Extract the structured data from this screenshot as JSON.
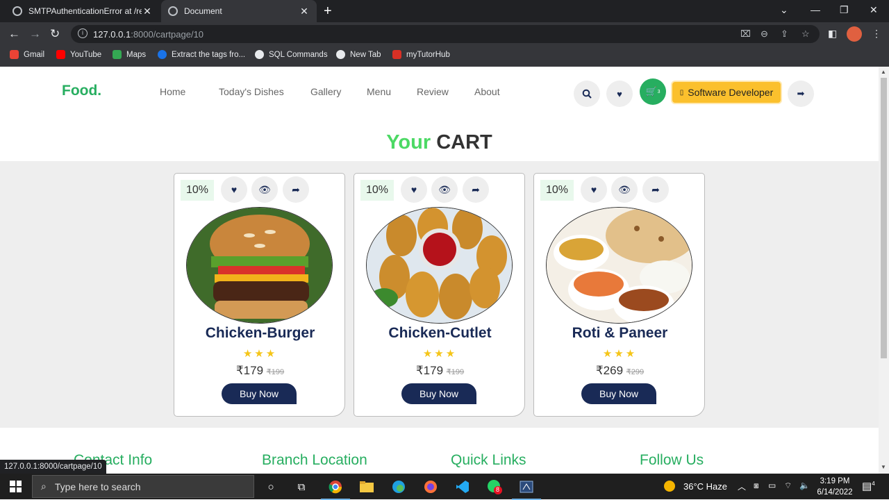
{
  "browser": {
    "tabs": [
      {
        "title": "SMTPAuthenticationError at /reg",
        "active": false
      },
      {
        "title": "Document",
        "active": true
      }
    ],
    "url_host": "127.0.0.1",
    "url_path": ":8000/cartpage/10",
    "bookmarks": [
      {
        "label": "Gmail",
        "color": "#ea4335"
      },
      {
        "label": "YouTube",
        "color": "#ff0000"
      },
      {
        "label": "Maps",
        "color": "#34a853"
      },
      {
        "label": "Extract the tags fro...",
        "color": "#1a73e8"
      },
      {
        "label": "SQL Commands",
        "color": "#e8eaed"
      },
      {
        "label": "New Tab",
        "color": "#e8eaed"
      },
      {
        "label": "myTutorHub",
        "color": "#d93025"
      }
    ],
    "status_url": "127.0.0.1:8000/cartpage/10"
  },
  "site": {
    "logo": "Food.",
    "nav": [
      "Home",
      "Today's Dishes",
      "Gallery",
      "Menu",
      "Review",
      "About"
    ],
    "cart_count": "3",
    "user_label": "Software Developer",
    "accent": "#27ae60",
    "navy": "#192a56"
  },
  "cart": {
    "title_accent": "Your",
    "title_main": "CART",
    "items": [
      {
        "discount": "10%",
        "name": "Chicken-Burger",
        "stars": "★★★",
        "price": "₹179",
        "old_price": "₹199",
        "button": "Buy Now"
      },
      {
        "discount": "10%",
        "name": "Chicken-Cutlet",
        "stars": "★★★",
        "price": "₹179",
        "old_price": "₹199",
        "button": "Buy Now"
      },
      {
        "discount": "10%",
        "name": "Roti & Paneer",
        "stars": "★★★",
        "price": "₹269",
        "old_price": "₹299",
        "button": "Buy Now"
      }
    ]
  },
  "footer": {
    "headings": [
      "Contact Info",
      "Branch Location",
      "Quick Links",
      "Follow Us"
    ]
  },
  "taskbar": {
    "search_placeholder": "Type here to search",
    "weather": "36°C  Haze",
    "time": "3:19 PM",
    "date": "6/14/2022",
    "whatsapp_badge": "8",
    "notifications": "4"
  }
}
